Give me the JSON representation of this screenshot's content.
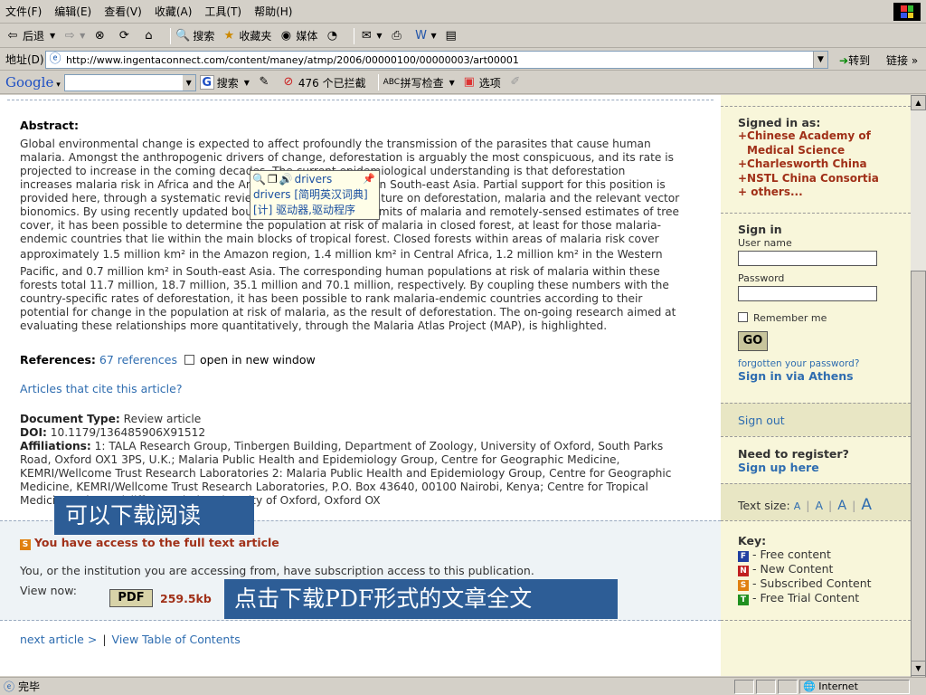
{
  "menubar": {
    "items": [
      "文件(F)",
      "编辑(E)",
      "查看(V)",
      "收藏(A)",
      "工具(T)",
      "帮助(H)"
    ]
  },
  "toolbar": {
    "back": "后退",
    "search": "搜索",
    "favorites": "收藏夹",
    "media": "媒体"
  },
  "address": {
    "label": "地址(D)",
    "url": "http://www.ingentaconnect.com/content/maney/atmp/2006/00000100/00000003/art00001",
    "go": "转到",
    "links": "链接"
  },
  "googlebar": {
    "logo": "Google",
    "search": "搜索",
    "blocked": "476 个已拦截",
    "spell": "拼写检查",
    "options": "选项"
  },
  "abstract": {
    "title": "Abstract:",
    "lines": [
      "Global environmental change is expected to affect profoundly the transmission of the parasites that cause human",
      "malaria. Amongst the anthropogenic drivers of change, deforestation is arguably the most conspicuous, and its rate is",
      "projected to increase in the coming decades. The current epidemiological understanding is that deforestation",
      "increases malaria risk in Africa and the Americas, but reduces it in South-east Asia. Partial support for this position is",
      "provided here, through a systematic review of the scientific literature on deforestation, malaria and the relevant vector",
      "bionomics. By using recently updated boundaries of the spatial limits of malaria and remotely-sensed estimates of tree",
      "cover, it has been possible to determine the population at risk of malaria in closed forest, at least for those malaria-",
      "endemic countries that lie within the main blocks of tropical forest. Closed forests within areas of malaria risk cover",
      "approximately 1.5 million km² in the Amazon region, 1.4 million km² in Central Africa, 1.2 million km² in the Western",
      "Pacific, and 0.7 million km² in South-east Asia. The corresponding human populations at risk of malaria within these",
      "forests total 11.7 million, 18.7 million, 35.1 million and 70.1 million, respectively. By coupling these numbers with the",
      "country-specific rates of deforestation, it has been possible to rank malaria-endemic countries according to their",
      "potential for change in the population at risk of malaria, as the result of deforestation. The on-going research aimed at",
      "evaluating these relationships more quantitatively, through the Malaria Atlas Project (MAP), is highlighted."
    ]
  },
  "references": {
    "label": "References:",
    "link": "67 references",
    "new_window": "open in new window"
  },
  "cite_link": "Articles that cite this article?",
  "docinfo": {
    "type_label": "Document Type:",
    "type_value": "Review article",
    "doi_label": "DOI:",
    "doi_value": "10.1179/136485906X91512",
    "aff_label": "Affiliations:",
    "aff_line1": "1: TALA Research Group, Tinbergen Building, Department of Zoology, University of Oxford, South Parks",
    "aff_line2": "Road, Oxford OX1 3PS, U.K.; Malaria Public Health and Epidemiology Group, Centre for Geographic Medicine,",
    "aff_line3": "KEMRI/Wellcome Trust Research Laboratories 2: Malaria Public Health and Epidemiology Group, Centre for Geographic",
    "aff_line4": "Medicine, KEMRI/Wellcome Trust Research Laboratories, P.O. Box 43640, 00100 Nairobi, Kenya; Centre for Tropical",
    "aff_line5": "Medicine, John Radcliffe Hospital, University of Oxford, Oxford OX"
  },
  "access": {
    "badge": "S",
    "title": "You have access to the full text article",
    "text": "You, or the institution you are accessing from, have subscription access to this publication.",
    "view_now": "View now:",
    "pdf_label": "PDF",
    "pdf_size": "259.5kb"
  },
  "nav": {
    "next": "next article >",
    "toc": "View Table of Contents"
  },
  "overlays": {
    "download_read": "可以下载阅读",
    "download_pdf": "点击下载PDF形式的文章全文"
  },
  "dict_popup": {
    "word": "drivers",
    "line2": "drivers [简明英汉词典]",
    "line3": "[计] 驱动器,驱动程序"
  },
  "sidebar": {
    "signed_in": "Signed in as:",
    "orgs": [
      "+Chinese Academy of",
      " Medical Science",
      "+Charlesworth China",
      "+NSTL China Consortia"
    ],
    "others": "+  others...",
    "sign_in": "Sign in",
    "username": "User name",
    "password": "Password",
    "remember": "Remember me",
    "go": "GO",
    "forgot": "forgotten your password?",
    "athens": "Sign in via Athens",
    "sign_out": "Sign out",
    "register_q": "Need to register?",
    "signup": "Sign up here",
    "text_size": "Text size:",
    "size_a": "A",
    "key_title": "Key:",
    "key_items": [
      {
        "badge": "F",
        "color": "#2040a0",
        "label": "- Free content"
      },
      {
        "badge": "N",
        "color": "#c02020",
        "label": "- New Content"
      },
      {
        "badge": "S",
        "color": "#e08010",
        "label": "- Subscribed Content"
      },
      {
        "badge": "T",
        "color": "#209020",
        "label": "- Free Trial Content"
      }
    ]
  },
  "status": {
    "done": "完毕",
    "zone": "Internet"
  }
}
